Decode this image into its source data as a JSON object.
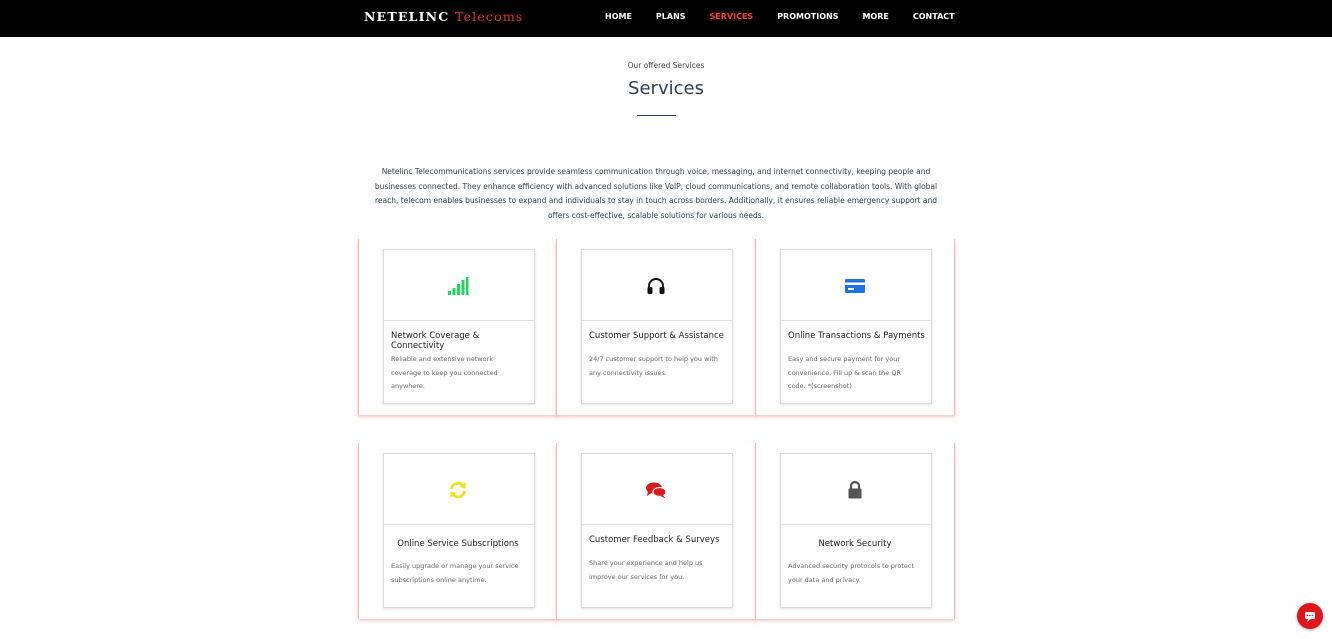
{
  "brand": {
    "name": "NETELINC",
    "accent": "Telecoms"
  },
  "nav": [
    {
      "label": "HOME",
      "active": false
    },
    {
      "label": "PLANS",
      "active": false
    },
    {
      "label": "SERVICES",
      "active": true
    },
    {
      "label": "PROMOTIONS",
      "active": false
    },
    {
      "label": "MORE",
      "active": false
    },
    {
      "label": "CONTACT",
      "active": false
    }
  ],
  "section": {
    "subtitle": "Our offered Services",
    "title": "Services",
    "intro": "Netelinc Telecommunications services provide seamless communication through voice, messaging, and internet connectivity, keeping people and businesses connected. They enhance efficiency with advanced solutions like VoIP, cloud communications, and remote collaboration tools. With global reach, telecom enables businesses to expand and individuals to stay in touch across borders. Additionally, it ensures reliable emergency support and offers cost-effective, scalable solutions for various needs."
  },
  "services": [
    {
      "icon": "signal-bars-icon",
      "color": "#1ed760",
      "title": "Network Coverage & Connectivity",
      "desc": "Reliable and extensive network coverage to keep you connected anywhere."
    },
    {
      "icon": "headphones-icon",
      "color": "#111111",
      "title": "Customer Support & Assistance",
      "desc": "24/7 customer support to help you with any connectivity issues."
    },
    {
      "icon": "credit-card-icon",
      "color": "#1a73e8",
      "title": "Online Transactions & Payments",
      "desc": "Easy and secure payment for your convenience. Fill up & scan the QR code. *(screenshot)"
    },
    {
      "icon": "sync-icon",
      "color": "#e6e61a",
      "title": "Online Service Subscriptions",
      "desc": "Easily upgrade or manage your service subscriptions online anytime."
    },
    {
      "icon": "chat-bubbles-icon",
      "color": "#d81b1b",
      "title": "Customer Feedback & Surveys",
      "desc": "Share your experience and help us improve our services for you."
    },
    {
      "icon": "lock-icon",
      "color": "#555555",
      "title": "Network Security",
      "desc": "Advanced security protocols to protect your data and privacy."
    }
  ],
  "chat_button": {
    "icon": "chat-icon",
    "color": "#e0141c"
  }
}
